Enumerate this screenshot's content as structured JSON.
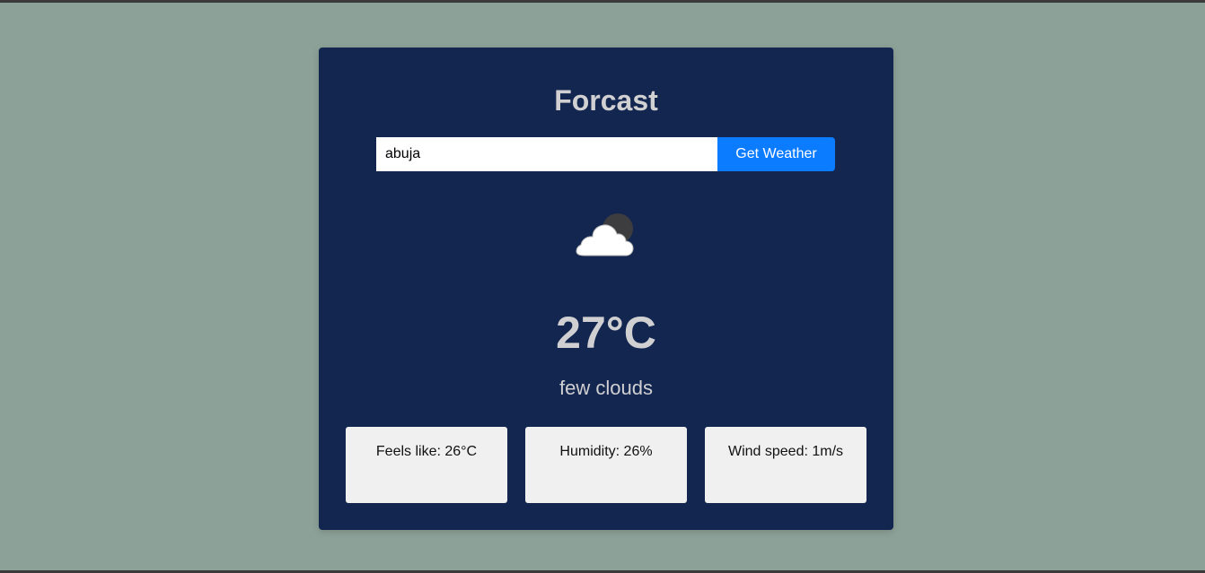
{
  "app": {
    "title": "Forcast"
  },
  "search": {
    "value": "abuja",
    "button_label": "Get Weather"
  },
  "weather": {
    "icon": "few-clouds-night-icon",
    "temperature": "27°C",
    "description": "few clouds"
  },
  "details": [
    {
      "label": "Feels like: 26°C"
    },
    {
      "label": "Humidity: 26%"
    },
    {
      "label": "Wind speed: 1m/s"
    }
  ],
  "colors": {
    "page_background": "#8ca197",
    "card_background": "#13264f",
    "accent": "#0b7bff",
    "text": "#d0d0d3",
    "detail_background": "#f0f0f0"
  }
}
